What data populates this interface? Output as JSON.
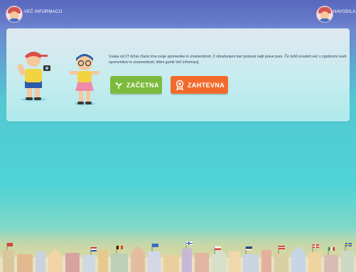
{
  "header": {
    "more_info_label": "VEČ INFORMACIJ",
    "profile_label": "NAVODILA"
  },
  "intro_text": "Vsaka od 27 držav članic ima svoje spomenike in znamenitosti. Z obračanjem kart poskusi najti prave pare. Če želiš izvedeti več o zgodovini vseh spomenikov in znamenitosti, klikni gumb Več informacij.",
  "buttons": {
    "easy_label": "ZAČETNA",
    "hard_label": "ZAHTEVNA"
  },
  "colors": {
    "topbar": "#5868be",
    "easy": "#7cba3c",
    "hard": "#f26b2d",
    "background": "#4fd3d6"
  }
}
